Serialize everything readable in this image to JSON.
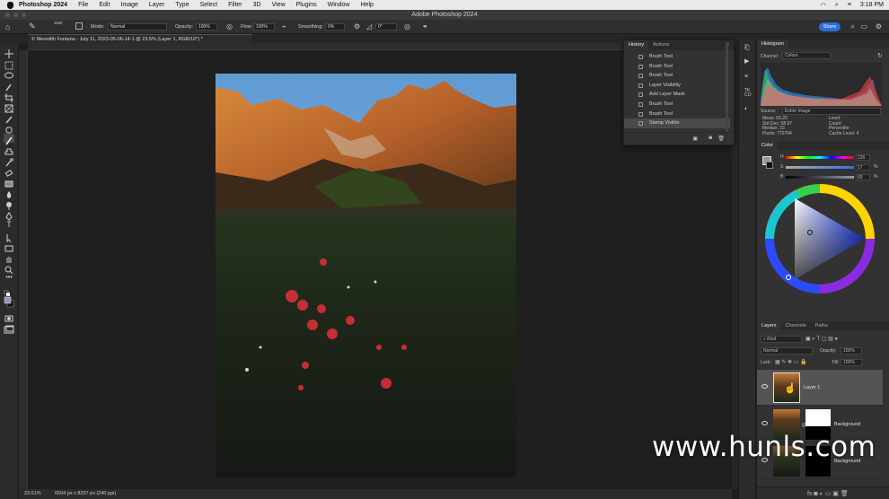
{
  "menubar": {
    "app_name": "Photoshop 2024",
    "items": [
      "File",
      "Edit",
      "Image",
      "Layer",
      "Type",
      "Select",
      "Filter",
      "3D",
      "View",
      "Plugins",
      "Window",
      "Help"
    ],
    "clock": "3:18 PM"
  },
  "window": {
    "title": "Adobe Photoshop 2024"
  },
  "options": {
    "brush_size": "1162",
    "mode_label": "Mode:",
    "mode_value": "Normal",
    "opacity_label": "Opacity:",
    "opacity_value": "100%",
    "flow_label": "Flow:",
    "flow_value": "100%",
    "smoothing_label": "Smoothing:",
    "smoothing_value": "0%",
    "angle_value": "0°",
    "share_label": "Share"
  },
  "document": {
    "tab_title": "© Meredith Fontana - July 11, 2023-05-06-14-1 @ 23.5% (Layer 1, RGB/16*) *",
    "zoom": "23.51%",
    "doc_info": "6504 px x 8257 px (240 ppi)"
  },
  "history": {
    "tabs": [
      "History",
      "Actions"
    ],
    "items": [
      {
        "label": "Brush Tool",
        "state": "normal"
      },
      {
        "label": "Brush Tool",
        "state": "normal"
      },
      {
        "label": "Brush Tool",
        "state": "normal"
      },
      {
        "label": "Layer Visibility",
        "state": "normal"
      },
      {
        "label": "Add Layer Mask",
        "state": "normal"
      },
      {
        "label": "Brush Tool",
        "state": "normal"
      },
      {
        "label": "Brush Tool",
        "state": "normal"
      },
      {
        "label": "Stamp Visible",
        "state": "selected"
      }
    ]
  },
  "histogram": {
    "title": "Histogram",
    "channel_label": "Channel:",
    "channel_value": "Colors",
    "source_label": "Source:",
    "source_value": "Entire Image",
    "stats_left": [
      "Mean: 55.20",
      "Std Dev: 58.97",
      "Median: 33",
      "Pixels: 770704"
    ],
    "stats_right": [
      "Level:",
      "Count:",
      "Percentile:",
      "Cache Level: 4"
    ]
  },
  "color": {
    "title": "Color",
    "h_value": "226",
    "s_value": "17",
    "b_value": "69",
    "pct": "%"
  },
  "layers": {
    "tabs": [
      "Layers",
      "Channels",
      "Paths"
    ],
    "kind_label": "Kind",
    "blend_mode": "Normal",
    "opacity_label": "Opacity:",
    "opacity_value": "100%",
    "lock_label": "Lock:",
    "fill_label": "Fill:",
    "fill_value": "100%",
    "items": [
      {
        "name": "Layer 1",
        "selected": true
      },
      {
        "name": "Background",
        "selected": false
      },
      {
        "name": "Background",
        "selected": false
      }
    ]
  },
  "watermark": {
    "text": "www.hunls.com"
  }
}
